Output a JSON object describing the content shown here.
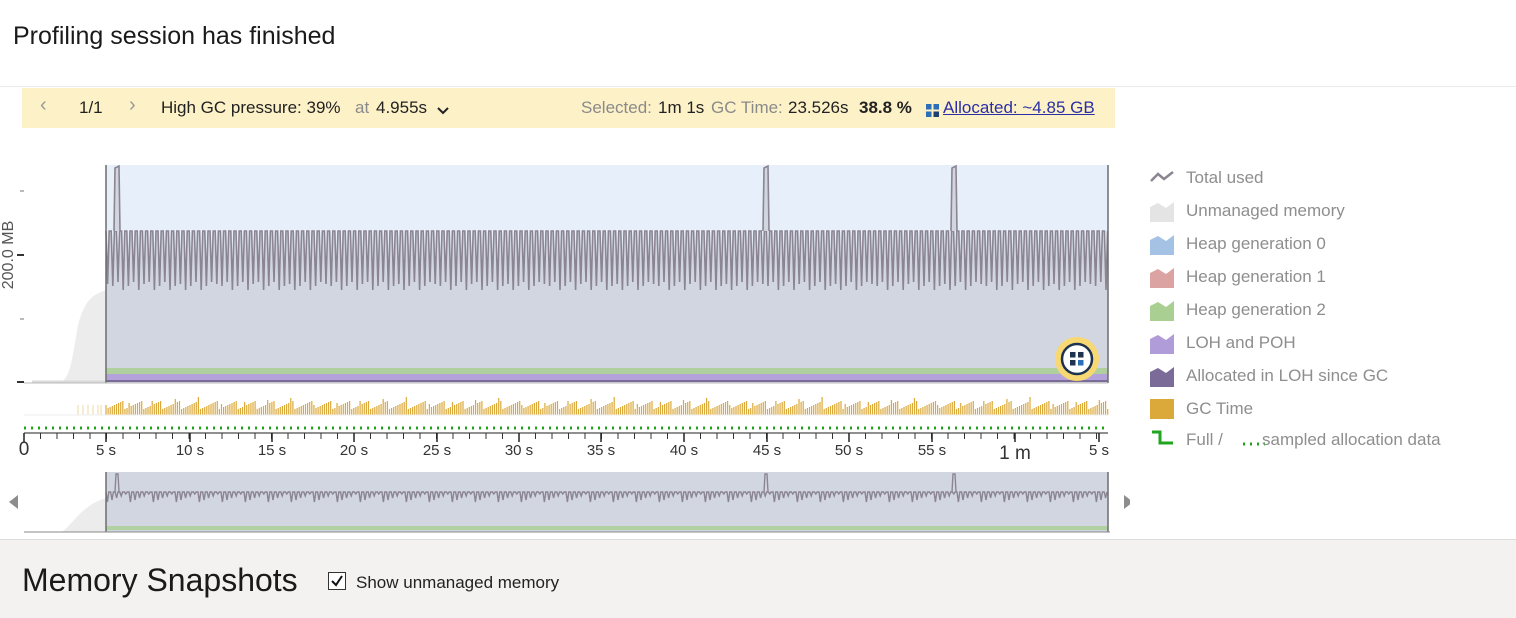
{
  "header": {
    "title": "Profiling session has finished"
  },
  "inspection_bar": {
    "prev_icon": "chevron-left-icon",
    "counter": "1/1",
    "next_icon": "chevron-right-icon",
    "issue_text": "High GC pressure: 39%",
    "at_label": "at",
    "at_value": "4.955s",
    "dropdown_icon": "chevron-down-icon",
    "selected_label": "Selected:",
    "selected_value": "1m 1s",
    "gc_time_label": "GC Time:",
    "gc_time_value": "23.526s",
    "gc_percent": "38.8 %",
    "allocated_icon": "grid-icon",
    "allocated_link": "Allocated: ~4.85 GB"
  },
  "chart": {
    "y_axis_label": "200.0 MB",
    "x_ticks": [
      "0",
      "5 s",
      "10 s",
      "15 s",
      "20 s",
      "25 s",
      "30 s",
      "35 s",
      "40 s",
      "45 s",
      "50 s",
      "55 s",
      "1 m",
      "5 s"
    ],
    "zoom_icon": "zoom-grid-icon",
    "overview_left_icon": "triangle-left-icon",
    "overview_right_icon": "triangle-right-icon"
  },
  "legend": [
    {
      "label": "Total used",
      "icon": "line-icon",
      "color": "#8a8591"
    },
    {
      "label": "Unmanaged memory",
      "icon": "area-icon",
      "color": "#e4e4e4"
    },
    {
      "label": "Heap generation 0",
      "icon": "area-icon",
      "color": "#a4c2e4"
    },
    {
      "label": "Heap generation 1",
      "icon": "area-icon",
      "color": "#dca3a3"
    },
    {
      "label": "Heap generation 2",
      "icon": "area-icon",
      "color": "#a9cf92"
    },
    {
      "label": "LOH and POH",
      "icon": "area-icon",
      "color": "#b09cd9"
    },
    {
      "label": "Allocated in LOH since GC",
      "icon": "area-icon",
      "color": "#7b6b98"
    },
    {
      "label": "GC Time",
      "icon": "square-icon",
      "color": "#dba93a"
    },
    {
      "label": "Full /",
      "label2": "sampled allocation data",
      "icon": "step-line-icon",
      "color": "#21a51f"
    }
  ],
  "snapshots": {
    "title": "Memory Snapshots",
    "checkbox_checked": true,
    "checkbox_label": "Show unmanaged memory"
  }
}
